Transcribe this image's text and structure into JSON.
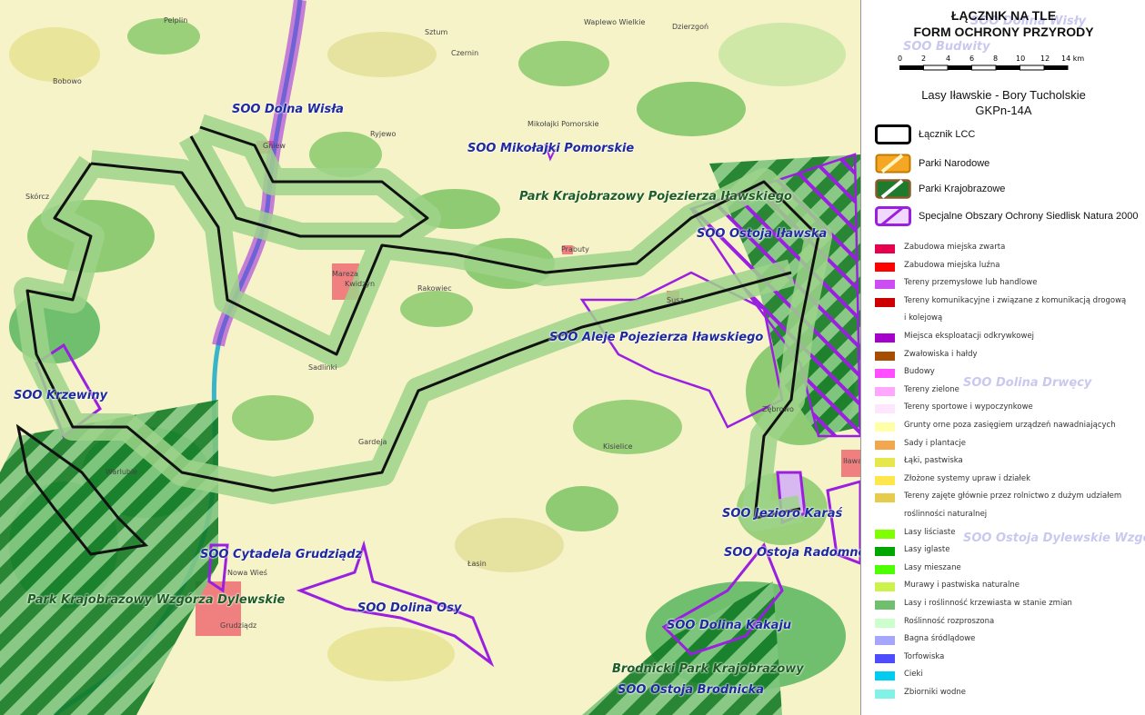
{
  "legend": {
    "title_line1": "ŁĄCZNIK NA TLE",
    "title_line2": "FORM OCHRONY PRZYRODY",
    "scale_ticks": [
      "0",
      "2",
      "4",
      "6",
      "8",
      "10",
      "12",
      "14 km"
    ],
    "subtitle_line1": "Lasy Iławskie - Bory Tucholskie",
    "subtitle_line2": "GKPn-14A",
    "symbols": [
      {
        "label": "Łącznik LCC",
        "kind": "lcc"
      },
      {
        "label": "Parki Narodowe",
        "kind": "np",
        "color": "#f5a623"
      },
      {
        "label": "Parki Krajobrazowe",
        "kind": "pk",
        "color": "#1e7a2c"
      },
      {
        "label": "Specjalne Obszary Ochrony Siedlisk Natura 2000",
        "kind": "soo",
        "color": "#9b1fe0"
      }
    ],
    "landuse": [
      {
        "label": "Zabudowa miejska zwarta",
        "color": "#e6004d"
      },
      {
        "label": "Zabudowa miejska luźna",
        "color": "#ff0000"
      },
      {
        "label": "Tereny przemysłowe lub handlowe",
        "color": "#cc4df2"
      },
      {
        "label": "Tereny komunikacyjne i związane z komunikacją drogową",
        "color": "#cc0000"
      },
      {
        "label": "i kolejową",
        "color": ""
      },
      {
        "label": "Miejsca eksploatacji odkrywkowej",
        "color": "#a600cc"
      },
      {
        "label": "Zwałowiska i hałdy",
        "color": "#a64d00"
      },
      {
        "label": "Budowy",
        "color": "#ff4dff"
      },
      {
        "label": "Tereny zielone",
        "color": "#ffa6ff"
      },
      {
        "label": "Tereny sportowe i wypoczynkowe",
        "color": "#ffe6ff"
      },
      {
        "label": "Grunty orne poza zasięgiem urządzeń nawadniających",
        "color": "#ffffa8"
      },
      {
        "label": "Sady i plantacje",
        "color": "#f2a64d"
      },
      {
        "label": "Łąki, pastwiska",
        "color": "#e6e64d"
      },
      {
        "label": "Złożone systemy upraw i działek",
        "color": "#ffe64d"
      },
      {
        "label": "Tereny zajęte głównie przez rolnictwo z dużym udziałem",
        "color": "#e6cc4d"
      },
      {
        "label": "roślinności naturalnej",
        "color": ""
      },
      {
        "label": "Lasy liściaste",
        "color": "#80ff00"
      },
      {
        "label": "Lasy iglaste",
        "color": "#00a600"
      },
      {
        "label": "Lasy mieszane",
        "color": "#4dff00"
      },
      {
        "label": "Murawy i pastwiska naturalne",
        "color": "#ccf24d"
      },
      {
        "label": "Lasy i roślinność krzewiasta w stanie zmian",
        "color": "#6fbf6f"
      },
      {
        "label": "Roślinność rozproszona",
        "color": "#ccffcc"
      },
      {
        "label": "Bagna śródlądowe",
        "color": "#a6a6ff"
      },
      {
        "label": "Torfowiska",
        "color": "#4d4dff"
      },
      {
        "label": "Cieki",
        "color": "#00ccf2"
      },
      {
        "label": "Zbiorniki wodne",
        "color": "#80f2e6"
      }
    ],
    "ghost_labels": [
      "SOO Dolina Wisły",
      "SOO Budwity",
      "SOO Dolina Drwęcy",
      "SOO Ostoja Dylewskie Wzgórza"
    ]
  },
  "map": {
    "labels": [
      {
        "text": "SOO Dolna Wisła",
        "type": "soo"
      },
      {
        "text": "SOO Mikołajki Pomorskie",
        "type": "soo"
      },
      {
        "text": "Park Krajobrazowy Pojezierza Iławskiego",
        "type": "park"
      },
      {
        "text": "SOO Ostoja Iławska",
        "type": "soo"
      },
      {
        "text": "SOO Aleje Pojezierza Iławskiego",
        "type": "soo"
      },
      {
        "text": "SOO Krzewiny",
        "type": "soo"
      },
      {
        "text": "SOO Jezioro Karaś",
        "type": "soo"
      },
      {
        "text": "SOO Ostoja Radomno",
        "type": "soo"
      },
      {
        "text": "SOO Cytadela Grudziądz",
        "type": "soo"
      },
      {
        "text": "Park Krajobrazowy Wzgórza Dylewskie",
        "type": "park"
      },
      {
        "text": "SOO Dolina Osy",
        "type": "soo"
      },
      {
        "text": "SOO Dolina Kakaju",
        "type": "soo"
      },
      {
        "text": "Brodnicki Park Krajobrazowy",
        "type": "park"
      },
      {
        "text": "SOO Ostoja Brodnicka",
        "type": "soo"
      }
    ],
    "towns": [
      "Pelplin",
      "Sztum",
      "Waplewo Wielkie",
      "Dzierzgoń",
      "Bobowo",
      "Czernin",
      "Mikołajki Pomorskie",
      "Gniew",
      "Ryjewo",
      "Skórcz",
      "Prabuty",
      "Mareza",
      "Kwidzyn",
      "Rakowiec",
      "Susz",
      "Sadlinki",
      "Gardeja",
      "Kisielice",
      "Zębrowo",
      "Warlubie",
      "Iława",
      "Nowa Wieś",
      "Grudziądz",
      "Łasin"
    ]
  }
}
